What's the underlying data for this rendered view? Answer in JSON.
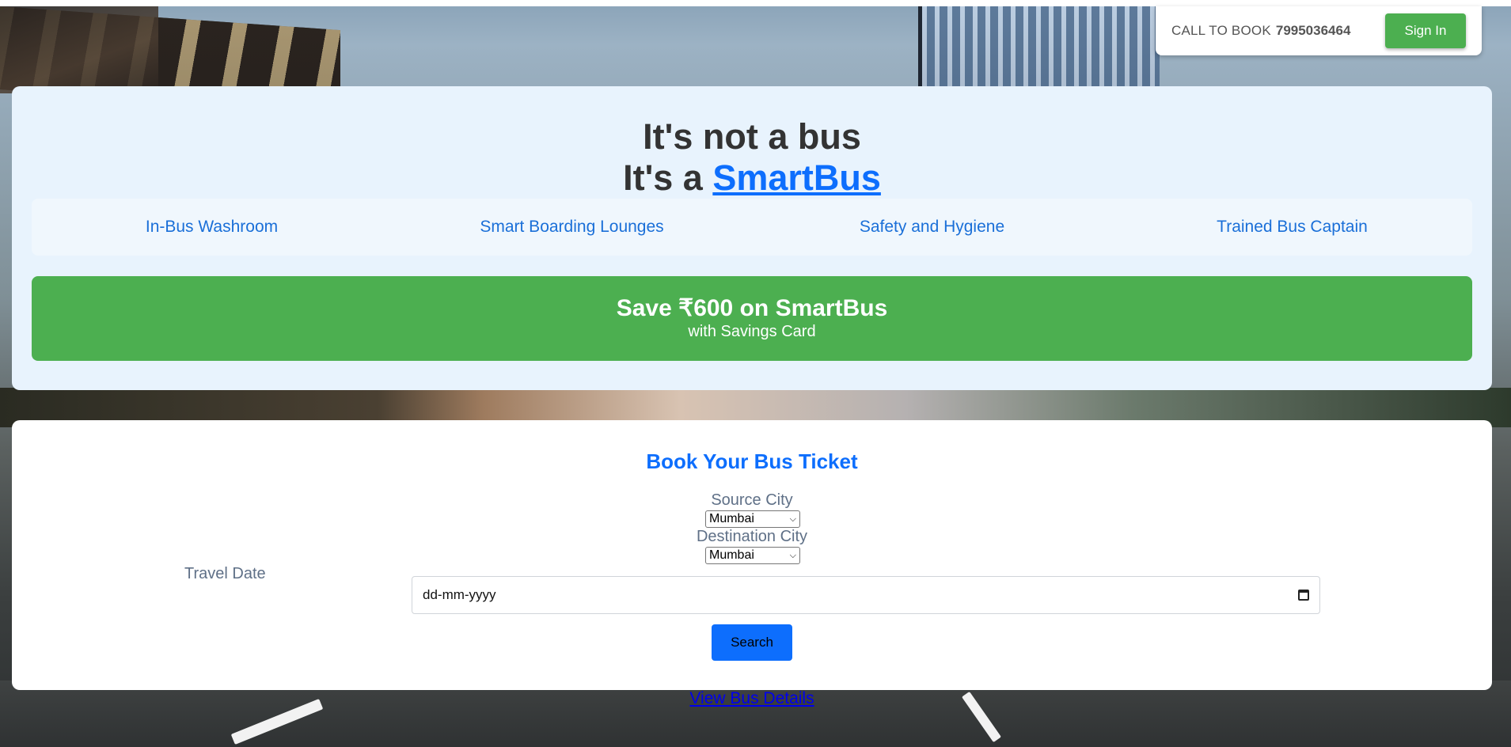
{
  "header": {
    "call_label": "CALL TO BOOK",
    "call_number": "7995036464",
    "signin_label": "Sign In"
  },
  "hero": {
    "line1": "It's not a bus",
    "line2_prefix": "It's a ",
    "brand_link": "SmartBus",
    "features": [
      {
        "label": "In-Bus Washroom"
      },
      {
        "label": "Smart Boarding Lounges"
      },
      {
        "label": "Safety and Hygiene"
      },
      {
        "label": "Trained Bus Captain"
      }
    ],
    "savings_title": "Save ₹600 on SmartBus",
    "savings_subtitle": "with Savings Card"
  },
  "booking": {
    "title": "Book Your Bus Ticket",
    "source_label": "Source City",
    "source_value": "Mumbai",
    "destination_label": "Destination City",
    "destination_value": "Mumbai",
    "date_label": "Travel Date",
    "date_placeholder": "dd-mm-yyyy",
    "search_label": "Search"
  },
  "footer": {
    "view_details_link": "View Bus Details"
  },
  "colors": {
    "primary": "#0d6efd",
    "success": "#4caf50",
    "hero_bg": "#e8f3fd",
    "feature_text": "#1a6fd8",
    "label_text": "#5f7087"
  },
  "icons": {
    "date_picker": "calendar-icon",
    "select_arrow": "chevron-down-icon"
  }
}
